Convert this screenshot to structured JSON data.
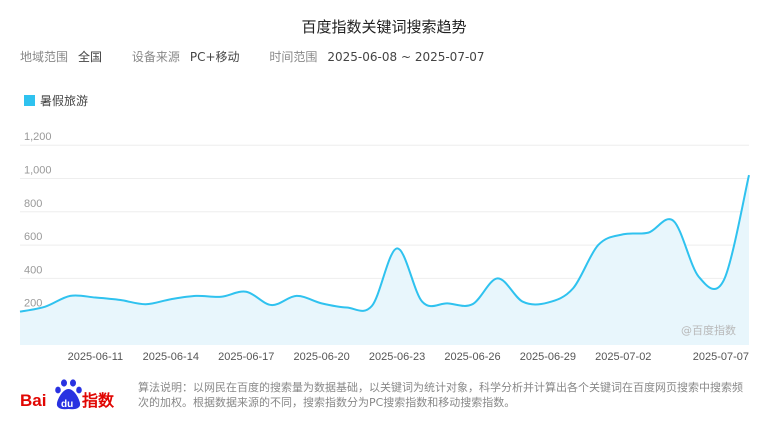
{
  "title": "百度指数关键词搜索趋势",
  "filters": {
    "region_label": "地域范围",
    "region_value": "全国",
    "source_label": "设备来源",
    "source_value": "PC+移动",
    "time_label": "时间范围",
    "time_value": "2025-06-08 ~ 2025-07-07"
  },
  "watermark": "@百度指数",
  "logo": {
    "text_bai": "Bai",
    "text_du": "du",
    "text_index": "指数"
  },
  "footnote": "算法说明：以网民在百度的搜索量为数据基础，以关键词为统计对象，科学分析并计算出各个关键词在百度网页搜索中搜索频次的加权。根据数据来源的不同，搜索指数分为PC搜索指数和移动搜索指数。",
  "colors": {
    "line": "#2fc2ef",
    "fill": "#e8f6fc",
    "grid": "#eeeeee"
  },
  "chart_data": {
    "type": "area",
    "title": "百度指数关键词搜索趋势",
    "xlabel": "",
    "ylabel": "",
    "ylim": [
      0,
      1200
    ],
    "yticks": [
      "200",
      "400",
      "600",
      "800",
      "1,000",
      "1,200"
    ],
    "xticks": [
      "2025-06-11",
      "2025-06-14",
      "2025-06-17",
      "2025-06-20",
      "2025-06-23",
      "2025-06-26",
      "2025-06-29",
      "2025-07-02",
      "2025-07-07"
    ],
    "legend_position": "top-left",
    "grid": true,
    "x": [
      "2025-06-08",
      "2025-06-09",
      "2025-06-10",
      "2025-06-11",
      "2025-06-12",
      "2025-06-13",
      "2025-06-14",
      "2025-06-15",
      "2025-06-16",
      "2025-06-17",
      "2025-06-18",
      "2025-06-19",
      "2025-06-20",
      "2025-06-21",
      "2025-06-22",
      "2025-06-23",
      "2025-06-24",
      "2025-06-25",
      "2025-06-26",
      "2025-06-27",
      "2025-06-28",
      "2025-06-29",
      "2025-06-30",
      "2025-07-01",
      "2025-07-02",
      "2025-07-03",
      "2025-07-04",
      "2025-07-05",
      "2025-07-06",
      "2025-07-07"
    ],
    "series": [
      {
        "name": "暑假旅游",
        "values": [
          200,
          230,
          295,
          285,
          270,
          245,
          275,
          295,
          290,
          320,
          240,
          295,
          250,
          225,
          235,
          580,
          260,
          250,
          245,
          400,
          260,
          255,
          340,
          600,
          665,
          675,
          745,
          410,
          390,
          1020
        ]
      }
    ]
  }
}
